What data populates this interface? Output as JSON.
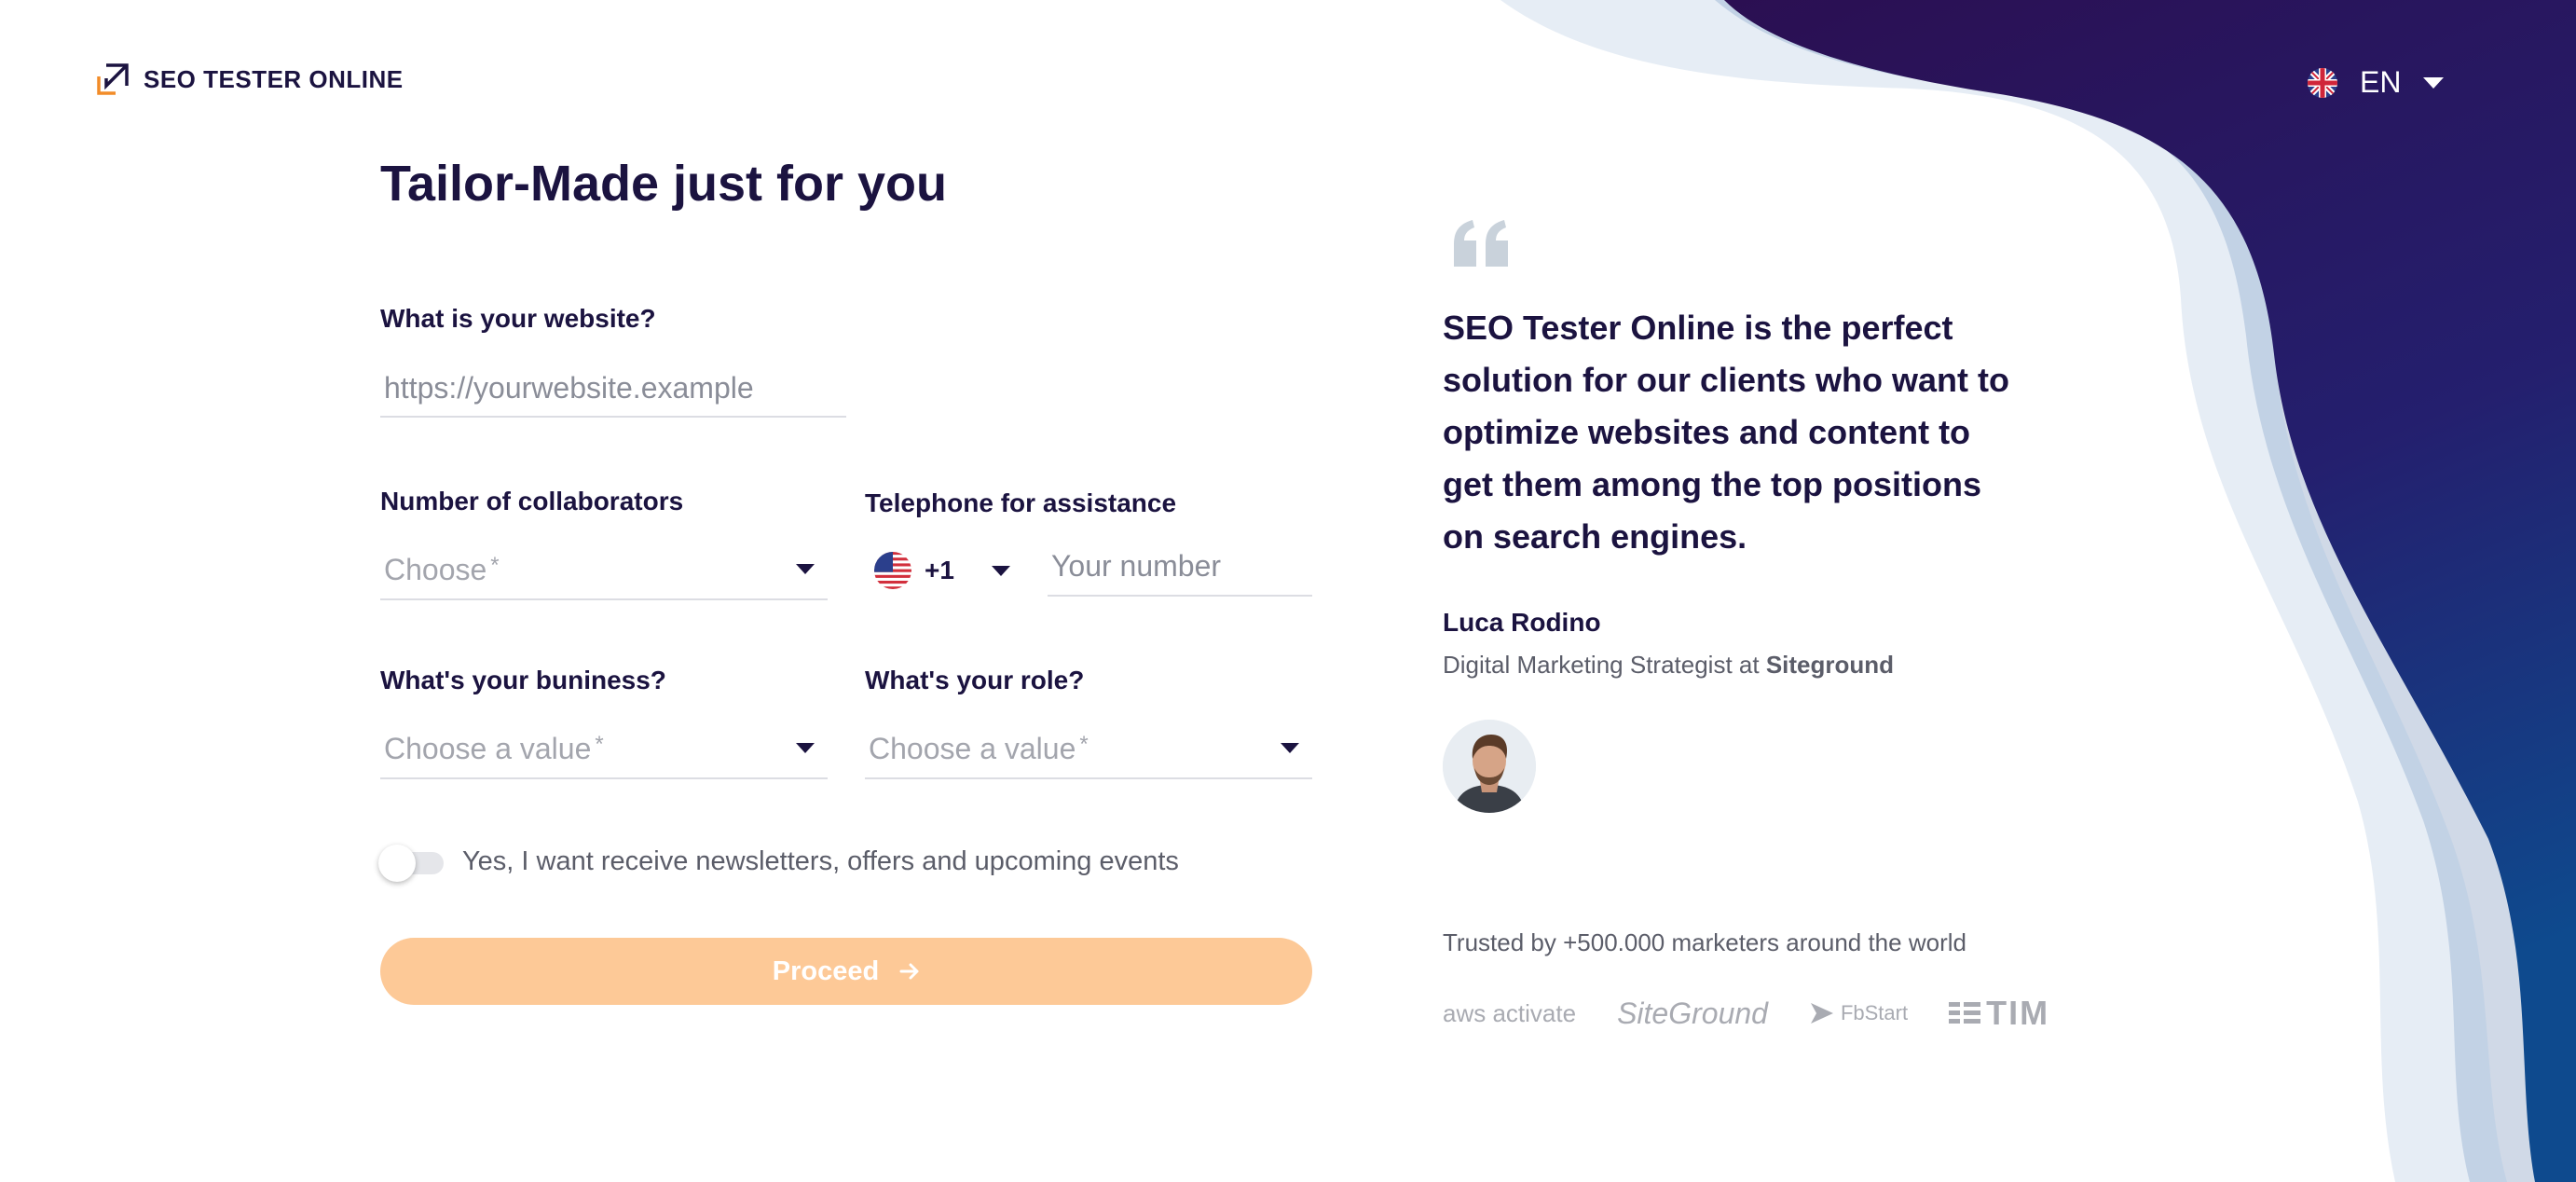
{
  "brand": {
    "logo_text": "SEO TESTER ONLINE"
  },
  "language": {
    "current": "EN"
  },
  "form": {
    "title": "Tailor-Made just for you",
    "website": {
      "label": "What is your website?",
      "placeholder": "https://yourwebsite.example"
    },
    "collaborators": {
      "label": "Number of collaborators",
      "placeholder": "Choose",
      "required": "*"
    },
    "telephone": {
      "label": "Telephone for assistance",
      "prefix": "+1",
      "placeholder": "Your number"
    },
    "business": {
      "label": "What's your buniness?",
      "placeholder": "Choose a value",
      "required": "*"
    },
    "role": {
      "label": "What's your role?",
      "placeholder": "Choose a value",
      "required": "*"
    },
    "newsletter": {
      "label": "Yes, I want receive newsletters, offers and upcoming events",
      "checked": false
    },
    "proceed_label": "Proceed"
  },
  "testimonial": {
    "quote": "SEO Tester Online is the perfect solution for our clients who want to optimize websites and content to get them among the top positions on search engines.",
    "author_name": "Luca Rodino",
    "author_role": "Digital Marketing Strategist at",
    "author_company": "Siteground"
  },
  "trusted": {
    "text": "Trusted by +500.000 marketers around the world",
    "logos": [
      "aws activate",
      "SiteGround",
      "FbStart",
      "TIM"
    ]
  },
  "colors": {
    "primary_text": "#1b1340",
    "button": "#fdc997",
    "wave_dark": "#2a1156",
    "wave_blue": "#0f4a8c"
  }
}
